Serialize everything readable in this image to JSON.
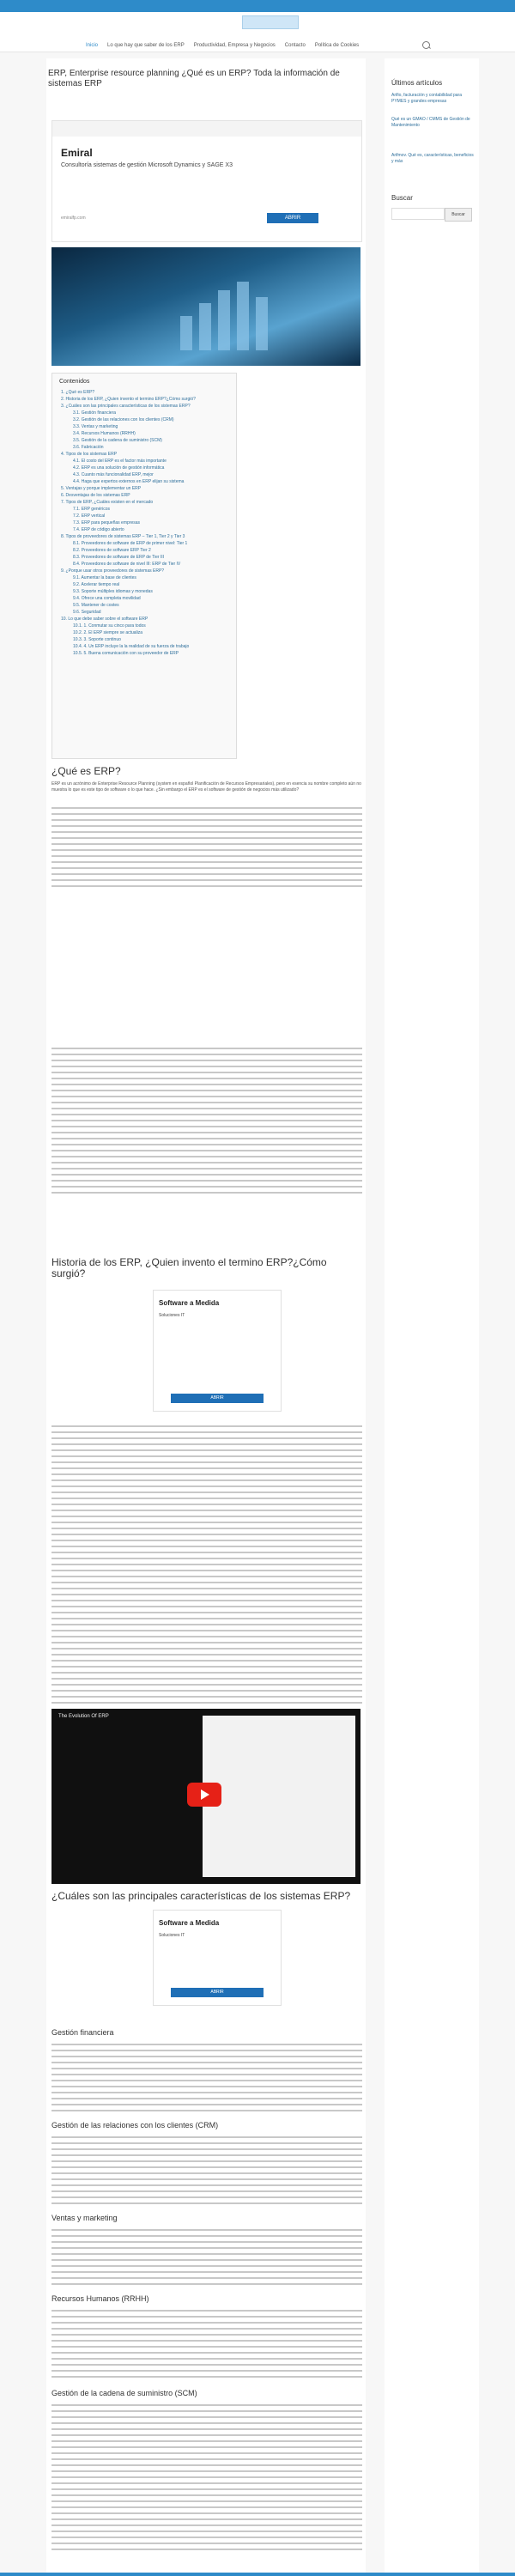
{
  "header": {
    "logo_text": "",
    "nav": [
      "Inicio",
      "Lo que hay que saber de los ERP",
      "Productividad, Empresa y Negocios",
      "Contacto",
      "Política de Cookies"
    ]
  },
  "article": {
    "title": "ERP, Enterprise resource planning ¿Qué es un ERP? Toda la información de sistemas ERP",
    "ad1": {
      "title": "Emiral",
      "subtitle": "Consultoría sistemas de gestión Microsoft Dynamics y SAGE X3",
      "url": "emiralfp.com",
      "button": "ABRIR"
    },
    "toc": {
      "title": "Contenidos",
      "items": [
        "1. ¿Qué es ERP?",
        "2. Historia de los ERP, ¿Quien invento el termino ERP?¿Cómo surgió?",
        "3. ¿Cuáles son las principales características de los sistemas ERP?",
        "3.1. Gestión financiera",
        "3.2. Gestión de las relaciones con los clientes (CRM)",
        "3.3. Ventas y marketing",
        "3.4. Recursos Humanos (RRHH)",
        "3.5. Gestión de la cadena de suministro (SCM)",
        "3.6. Fabricación",
        "4. Tipos de los sistemas ERP",
        "4.1. El costo del ERP es el factor más importante",
        "4.2. ERP es una solución de gestión informática",
        "4.3. Cuanto más funcionalidad ERP, mejor",
        "4.4. Haga que expertos externos en ERP elijan su sistema",
        "5. Ventajas y porque implementar un ERP",
        "6. Desventajas de los sistemas ERP",
        "7. Tipos de ERP, ¿Cuáles existen en el mercado",
        "7.1. ERP genéricos",
        "7.2. ERP vertical",
        "7.3. ERP para pequeñas empresas",
        "7.4. ERP de código abierto",
        "8. Tipos de proveedores de sistemas ERP – Tier 1, Tier 2 y Tier 3",
        "8.1. Proveedores de software de ERP de primer nivel: Tier 1",
        "8.2. Proveedores de software ERP Tier 2",
        "8.3. Proveedores de software de ERP de Tier III",
        "8.4. Proveedores de software de nivel III: ERP de Tier IV",
        "9. ¿Porque usar otros proveedores de sistemas ERP?",
        "9.1. Aumentar la base de clientes",
        "9.2. Acelerar tiempo real",
        "9.3. Soporte múltiples idiomas y monedas",
        "9.4. Ofrece una completa movilidad",
        "9.5. Mantener de costes",
        "9.6. Seguridad",
        "10. Lo que debe saber sobre el software ERP",
        "10.1. 1. Conmutar su cinco para todos",
        "10.2. 2. El ERP siempre se actualiza",
        "10.3. 3. Soporte continuo",
        "10.4. 4. Un ERP incluye la la realidad de su fuerza de trabajo",
        "10.5. 5. Buena comunicación con su proveedor de ERP"
      ]
    },
    "h_what": "¿Qué es ERP?",
    "p_what": "ERP es un acrónimo de Enterprise Resource Planning (system en español Planificación de Recursos Empresariales), pero en esencia su nombre completo aún no muestra lo que es este tipo de software o lo que hace. ¿Sin embargo el ERP es el software de gestión de negocios más utilizado?",
    "h_history": "Historia de los ERP, ¿Quien invento el termino ERP?¿Cómo surgió?",
    "ad_small": {
      "title": "Software a Medida",
      "subtitle": "Soluciones IT",
      "button": "ABRIR"
    },
    "h_features": "¿Cuáles son las principales características de los sistemas ERP?",
    "video_title": "The Evolution Of ERP",
    "h_finance": "Gestión financiera",
    "h_crm": "Gestión de las relaciones con los clientes (CRM)",
    "h_sales": "Ventas y marketing",
    "h_hr": "Recursos Humanos (RRHH)",
    "h_scm": "Gestión de la cadena de suministro (SCM)"
  },
  "sidebar": {
    "recent_title": "Últimos artículos",
    "recent": [
      "Arifio, facturación y contabilidad para PYMES y grandes empresas",
      "Qué es un GMAO / CMMS de Gestión de Mantenimiento",
      "Arifmov. Qué es, características, beneficios y más"
    ],
    "search_title": "Buscar",
    "search_button": "Buscar"
  }
}
